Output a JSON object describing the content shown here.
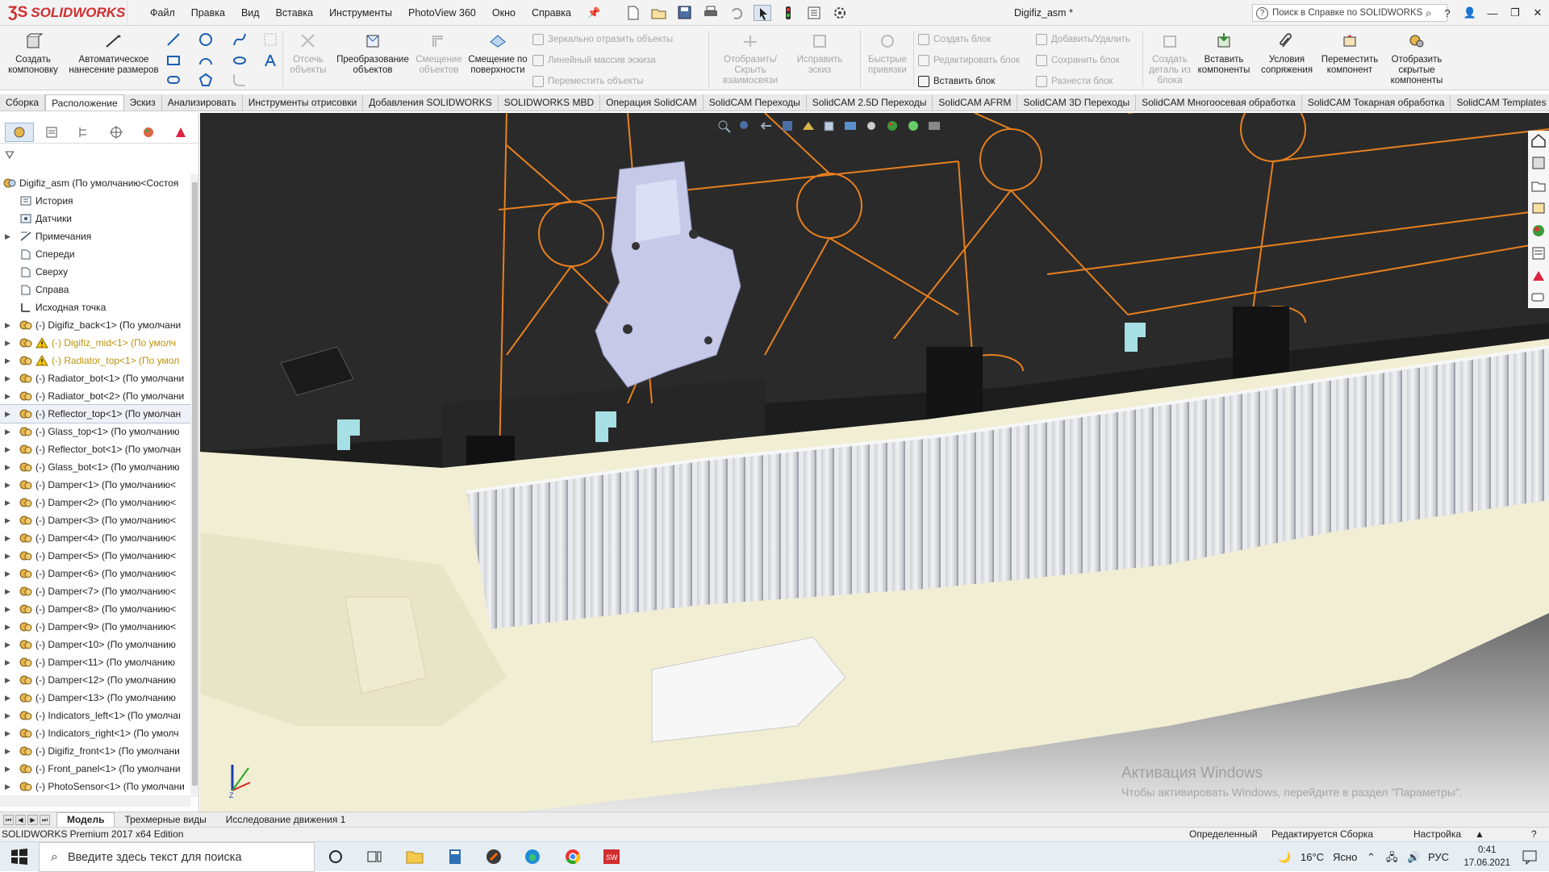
{
  "app": {
    "logo_text": "SOLIDWORKS",
    "document_title": "Digifiz_asm *"
  },
  "menu": [
    "Файл",
    "Правка",
    "Вид",
    "Вставка",
    "Инструменты",
    "PhotoView 360",
    "Окно",
    "Справка"
  ],
  "search": {
    "placeholder": "Поиск в Справке по SOLIDWORKS"
  },
  "command_manager": {
    "create_layout": "Создать компоновку",
    "auto_dim": "Автоматическое нанесение размеров",
    "trim": "Отсечь объекты",
    "convert": "Преобразование объектов",
    "offset": "Смещение объектов",
    "offset_surface": "Смещение по поверхности",
    "mirror": "Зеркально отразить объекты",
    "linear_pattern": "Линейный массив эскиза",
    "move": "Переместить объекты",
    "show_relations": "Отобразить/Скрыть взаимосвязи",
    "repair": "Исправить эскиз",
    "quick_snaps": "Быстрые привязки",
    "create_block": "Создать блок",
    "edit_block": "Редактировать блок",
    "insert_block": "Вставить блок",
    "add_remove": "Добавить/Удалить",
    "save_block": "Сохранить блок",
    "explode_block": "Разнести блок",
    "make_part": "Создать деталь из блока",
    "insert_components": "Вставить компоненты",
    "mates": "Условия сопряжения",
    "move_component": "Переместить компонент",
    "show_hidden": "Отобразить скрытые компоненты"
  },
  "tabs": [
    "Сборка",
    "Расположение",
    "Эскиз",
    "Анализировать",
    "Инструменты отрисовки",
    "Добавления SOLIDWORKS",
    "SOLIDWORKS MBD",
    "Операция SolidCAM",
    "SolidCAM Переходы",
    "SolidCAM 2.5D Переходы",
    "SolidCAM AFRM",
    "SolidCAM 3D Переходы",
    "SolidCAM Многоосевая обработка",
    "SolidCAM Токарная обработка",
    "SolidCAM Templates"
  ],
  "active_tab": "Расположение",
  "tree": {
    "root": "Digifiz_asm (По умолчанию<Состоя",
    "items": [
      {
        "label": "История",
        "icon": "history-icon"
      },
      {
        "label": "Датчики",
        "icon": "sensor-icon"
      },
      {
        "label": "Примечания",
        "icon": "annotation-icon",
        "expandable": true
      },
      {
        "label": "Спереди",
        "icon": "plane-icon"
      },
      {
        "label": "Сверху",
        "icon": "plane-icon"
      },
      {
        "label": "Справа",
        "icon": "plane-icon"
      },
      {
        "label": "Исходная точка",
        "icon": "origin-icon"
      },
      {
        "label": "(-) Digifiz_back<1> (По умолчани",
        "icon": "assembly-icon",
        "expandable": true
      },
      {
        "label": "(-) Digifiz_mid<1> (По умолч",
        "icon": "assembly-icon",
        "expandable": true,
        "warning": true
      },
      {
        "label": "(-) Radiator_top<1> (По умол",
        "icon": "assembly-icon",
        "expandable": true,
        "warning": true
      },
      {
        "label": "(-) Radiator_bot<1> (По умолчани",
        "icon": "assembly-icon",
        "expandable": true
      },
      {
        "label": "(-) Radiator_bot<2> (По умолчани",
        "icon": "assembly-icon",
        "expandable": true
      },
      {
        "label": "(-) Reflector_top<1> (По умолчан",
        "icon": "assembly-icon",
        "expandable": true,
        "selected": true
      },
      {
        "label": "(-) Glass_top<1> (По умолчанию",
        "icon": "assembly-icon",
        "expandable": true
      },
      {
        "label": "(-) Reflector_bot<1> (По умолчан",
        "icon": "assembly-icon",
        "expandable": true
      },
      {
        "label": "(-) Glass_bot<1> (По умолчанию",
        "icon": "assembly-icon",
        "expandable": true
      },
      {
        "label": "(-) Damper<1> (По умолчанию<",
        "icon": "assembly-icon",
        "expandable": true
      },
      {
        "label": "(-) Damper<2> (По умолчанию<",
        "icon": "assembly-icon",
        "expandable": true
      },
      {
        "label": "(-) Damper<3> (По умолчанию<",
        "icon": "assembly-icon",
        "expandable": true
      },
      {
        "label": "(-) Damper<4> (По умолчанию<",
        "icon": "assembly-icon",
        "expandable": true
      },
      {
        "label": "(-) Damper<5> (По умолчанию<",
        "icon": "assembly-icon",
        "expandable": true
      },
      {
        "label": "(-) Damper<6> (По умолчанию<",
        "icon": "assembly-icon",
        "expandable": true
      },
      {
        "label": "(-) Damper<7> (По умолчанию<",
        "icon": "assembly-icon",
        "expandable": true
      },
      {
        "label": "(-) Damper<8> (По умолчанию<",
        "icon": "assembly-icon",
        "expandable": true
      },
      {
        "label": "(-) Damper<9> (По умолчанию<",
        "icon": "assembly-icon",
        "expandable": true
      },
      {
        "label": "(-) Damper<10> (По умолчанию",
        "icon": "assembly-icon",
        "expandable": true
      },
      {
        "label": "(-) Damper<11> (По умолчанию",
        "icon": "assembly-icon",
        "expandable": true
      },
      {
        "label": "(-) Damper<12> (По умолчанию",
        "icon": "assembly-icon",
        "expandable": true
      },
      {
        "label": "(-) Damper<13> (По умолчанию",
        "icon": "assembly-icon",
        "expandable": true
      },
      {
        "label": "(-) Indicators_left<1> (По умолчаı",
        "icon": "assembly-icon",
        "expandable": true
      },
      {
        "label": "(-) Indicators_right<1> (По умолч",
        "icon": "assembly-icon",
        "expandable": true
      },
      {
        "label": "(-) Digifiz_front<1> (По умолчани",
        "icon": "assembly-icon",
        "expandable": true
      },
      {
        "label": "(-) Front_panel<1> (По умолчани",
        "icon": "assembly-icon",
        "expandable": true
      },
      {
        "label": "(-) PhotoSensor<1> (По умолчани",
        "icon": "assembly-icon",
        "expandable": true
      }
    ]
  },
  "bottom_tabs": [
    "Модель",
    "Трехмерные виды",
    "Исследование движения 1"
  ],
  "active_bottom_tab": "Модель",
  "watermark": {
    "title": "Активация Windows",
    "subtitle": "Чтобы активировать Windows, перейдите в раздел \"Параметры\"."
  },
  "status": {
    "edition": "SOLIDWORKS Premium 2017 x64 Edition",
    "state": "Определенный",
    "editing": "Редактируется Сборка",
    "settings": "Настройка"
  },
  "taskbar": {
    "search_placeholder": "Введите здесь текст для поиска",
    "temperature": "16°C",
    "weather": "Ясно",
    "lang": "РУС",
    "time": "0:41",
    "date": "17.06.2021"
  },
  "colors": {
    "brand_red": "#d12d2f",
    "edge_orange": "#e8801f",
    "selected_part": "#c7c9e8",
    "beige_part": "#f3f0d6",
    "dark_housing": "#2b2b2b"
  }
}
